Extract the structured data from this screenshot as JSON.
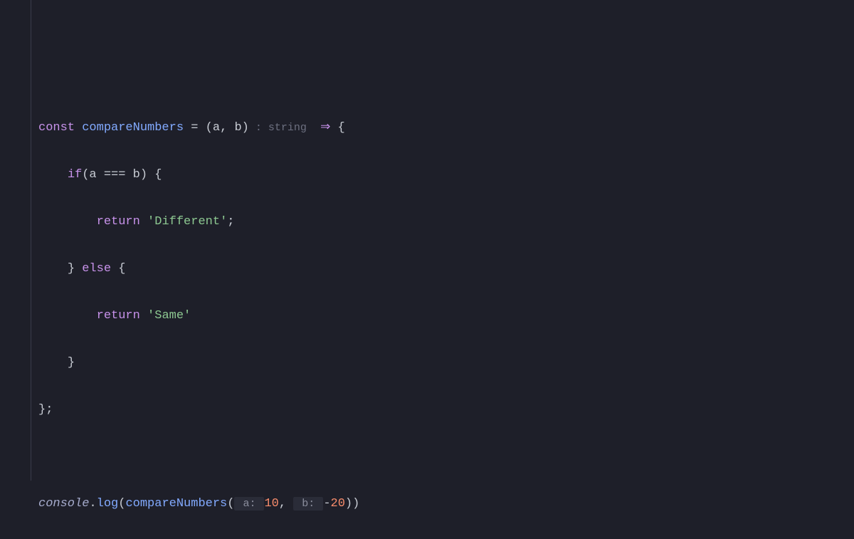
{
  "code": {
    "line1": {
      "const": "const",
      "fnName": "compareNumbers",
      "eq": " = ",
      "lp": "(",
      "paramA": "a",
      "comma1": ", ",
      "paramB": "b",
      "rp": ")",
      "hintType": " : string ",
      "arrow": " ⇒ ",
      "lbrace": "{"
    },
    "line2": {
      "indent": "    ",
      "if": "if",
      "lp": "(",
      "a": "a",
      "eqeq": " === ",
      "b": "b",
      "rp": ") ",
      "lbrace": "{"
    },
    "line3": {
      "indent": "        ",
      "return": "return",
      "sp": " ",
      "str": "'Different'",
      "semi": ";"
    },
    "line4": {
      "indent": "    ",
      "rbrace": "}",
      "sp": " ",
      "else": "else",
      "sp2": " ",
      "lbrace": "{"
    },
    "line5": {
      "indent": "        ",
      "return": "return",
      "sp": " ",
      "str": "'Same'"
    },
    "line6": {
      "indent": "    ",
      "rbrace": "}"
    },
    "line7": {
      "rbrace": "}",
      "semi": ";"
    },
    "line9": {
      "console": "console",
      "dot": ".",
      "log": "log",
      "lp": "(",
      "fn": "compareNumbers",
      "lp2": "(",
      "hintA": " a: ",
      "numA": "10",
      "comma": ", ",
      "hintB": " b: ",
      "minus": "-",
      "numB": "20",
      "rp": "))"
    }
  }
}
